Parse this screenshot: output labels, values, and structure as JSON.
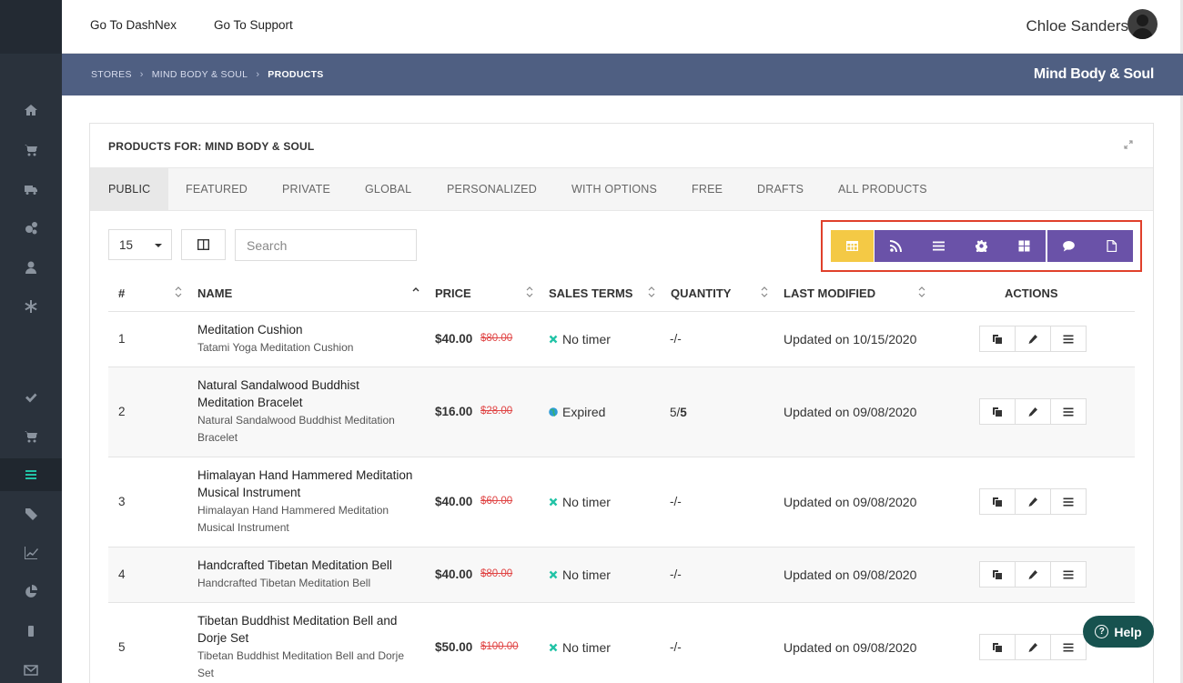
{
  "header": {
    "nav": [
      "Go To DashNex",
      "Go To Support"
    ],
    "user_name": "Chloe Sanders"
  },
  "breadcrumb": {
    "items": [
      "STORES",
      "MIND BODY & SOUL",
      "PRODUCTS"
    ],
    "store_title": "Mind Body & Soul"
  },
  "sidebar": {
    "icons": [
      "home-icon",
      "cart-icon",
      "truck-icon",
      "gears-icon",
      "user-icon",
      "asterisk-icon",
      "check-icon",
      "cart-icon",
      "list-icon",
      "tags-icon",
      "line-chart-icon",
      "pie-chart-icon",
      "mobile-icon",
      "envelope-icon"
    ],
    "active_icon": "list-icon",
    "active_color": "#22c3a6"
  },
  "panel": {
    "title": "PRODUCTS FOR: MIND BODY & SOUL",
    "tabs": [
      "PUBLIC",
      "FEATURED",
      "PRIVATE",
      "GLOBAL",
      "PERSONALIZED",
      "WITH OPTIONS",
      "FREE",
      "DRAFTS",
      "ALL PRODUCTS"
    ],
    "active_tab": "PUBLIC"
  },
  "controls": {
    "per_page": "15",
    "search_placeholder": "Search",
    "view_buttons": [
      "table-icon",
      "rss-icon",
      "list-icon",
      "gear-icon",
      "grid-icon",
      "comment-icon",
      "file-icon"
    ],
    "active_view": "table-icon",
    "active_color": "#f4c945",
    "button_color": "#6a52a8"
  },
  "table": {
    "headers": [
      "#",
      "NAME",
      "PRICE",
      "SALES TERMS",
      "QUANTITY",
      "LAST MODIFIED",
      "ACTIONS"
    ],
    "rows": [
      {
        "num": "1",
        "name": "Meditation Cushion",
        "subtitle": "Tatami Yoga Meditation Cushion",
        "price": "$40.00",
        "old_price": "$80.00",
        "term": "No timer",
        "term_icon": "x-icon",
        "qty": "-/-",
        "qty_bold": "",
        "modified": "Updated on 10/15/2020"
      },
      {
        "num": "2",
        "name": "Natural Sandalwood Buddhist Meditation Bracelet",
        "subtitle": "Natural Sandalwood Buddhist Meditation Bracelet",
        "price": "$16.00",
        "old_price": "$28.00",
        "term": "Expired",
        "term_icon": "globe-icon",
        "qty": "5/",
        "qty_bold": "5",
        "modified": "Updated on 09/08/2020"
      },
      {
        "num": "3",
        "name": "Himalayan Hand Hammered Meditation Musical Instrument",
        "subtitle": "Himalayan Hand Hammered Meditation Musical Instrument",
        "price": "$40.00",
        "old_price": "$60.00",
        "term": "No timer",
        "term_icon": "x-icon",
        "qty": "-/-",
        "qty_bold": "",
        "modified": "Updated on 09/08/2020"
      },
      {
        "num": "4",
        "name": "Handcrafted Tibetan Meditation Bell",
        "subtitle": "Handcrafted Tibetan Meditation Bell",
        "price": "$40.00",
        "old_price": "$80.00",
        "term": "No timer",
        "term_icon": "x-icon",
        "qty": "-/-",
        "qty_bold": "",
        "modified": "Updated on 09/08/2020"
      },
      {
        "num": "5",
        "name": "Tibetan Buddhist Meditation Bell and Dorje Set",
        "subtitle": "Tibetan Buddhist Meditation Bell and Dorje Set",
        "price": "$50.00",
        "old_price": "$100.00",
        "term": "No timer",
        "term_icon": "x-icon",
        "qty": "-/-",
        "qty_bold": "",
        "modified": "Updated on 09/08/2020"
      }
    ],
    "row_actions": [
      "copy-icon",
      "pencil-icon",
      "menu-icon"
    ]
  },
  "help": {
    "label": "Help"
  },
  "colors": {
    "band": "#4f5f82",
    "sidebar": "#2a323c",
    "term_x": "#22c3a6",
    "old_price": "#e04545",
    "help": "#17524f"
  }
}
